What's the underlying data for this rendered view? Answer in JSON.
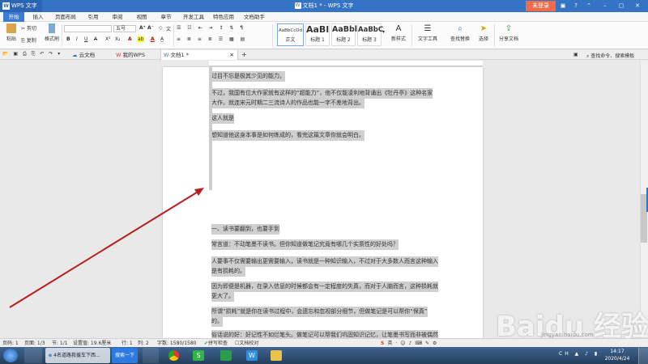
{
  "titlebar": {
    "app_menu": "WPS 文字",
    "doc_title": "文档1 * - WPS 文字",
    "login": "未登录"
  },
  "menu_tabs": [
    "开始",
    "插入",
    "页面布局",
    "引用",
    "审阅",
    "视图",
    "章节",
    "开发工具",
    "特色应用",
    "文档助手"
  ],
  "ribbon": {
    "paste": "粘贴",
    "cut": "剪切",
    "copy": "复制",
    "format_painter": "格式刷",
    "font_name": "",
    "font_size": "五号",
    "styles": [
      {
        "preview": "AaBbCcDd",
        "label": "正文"
      },
      {
        "preview": "AaBl",
        "label": "标题 1"
      },
      {
        "preview": "AaBbl",
        "label": "标题 2"
      },
      {
        "preview": "AaBbC",
        "label": "标题 3"
      }
    ],
    "new_style": "新样式",
    "text_tools": "文字工具",
    "find_replace": "查找替换",
    "select": "选择",
    "share": "分享文档"
  },
  "doc_tabs": {
    "cloud": "云文档",
    "mywps": "我的WPS",
    "doc1": "文档1 *"
  },
  "search_cmd": "查找命令、搜索模板",
  "document": {
    "paragraphs": [
      "过目不忘是极其少见的能力。",
      "不过，我国有位大作家就有这样的“超能力”，他不仅能凌利地背诵出《牡丹亭》这种名家",
      "大作，就连宋元时期二三流诗人的作品也能一字不差地背出。",
      "这人就是",
      "想知道他这身本事是如何练成的，看完这篇文章你就会明白。",
      "一、读书要翻到，也要手到",
      "常言道：不动笔墨不读书。但你知道做笔记究竟有哪几个实质性的好处吗？",
      "人要事不仅需要输出更需要输入，读书就是一种知识输入，不过对于大多数人而言这种输入",
      "是有损耗的。",
      "因为即便是机器，在录入信息的时候都会有一定程度的失真，而对于人脑而言，这种损耗就",
      "更大了。",
      "所谓“损耗”就是你在读书过程中，会遗忘和忽视部分细节，但做笔记是可以帮你“保真”",
      "的。",
      "俗话说的好：好记性不如烂笔头。做笔记可以帮我们巩固知识记忆，让笔墨书写而非被偶然"
    ]
  },
  "statusbar": {
    "page": "页码: 1",
    "pages": "页面: 1/3",
    "section": "节: 1/1",
    "setting": "设置值: 19.6厘米",
    "row": "行: 1",
    "col": "列: 2",
    "words": "字数: 1580/1580",
    "spell": "拼写检查",
    "proof": "文档校对"
  },
  "taskbar": {
    "browser_item": "4名道路救援车下西...",
    "search_btn": "搜索一下",
    "time": "14:17",
    "date": "2020/4/24"
  },
  "watermark": "Baidu 经验",
  "watermark_url": "jingyan.baidu.com",
  "colors": {
    "accent": "#3574c4",
    "login": "#ef6c4a",
    "arrow": "#b81c1c"
  }
}
